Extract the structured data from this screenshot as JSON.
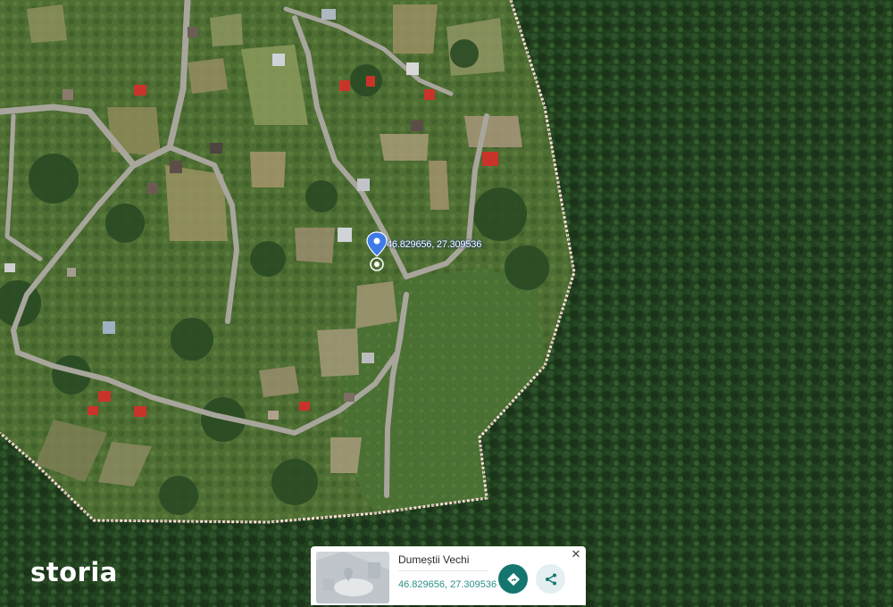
{
  "map": {
    "pin_label": "46.829656, 27.309536",
    "colors": {
      "forest": "#1f3a1c",
      "field": "#5a7a3c",
      "road": "#a7a59c",
      "boundary": "#f3e6df",
      "marker": "#3f7be8",
      "roof_red": "#c9342a"
    }
  },
  "watermark": {
    "text": "storia"
  },
  "info_card": {
    "title": "Dumeștii Vechi",
    "coordinates": "46.829656, 27.309536",
    "directions_icon": "directions-icon",
    "share_icon": "share-icon",
    "close_label": "✕"
  }
}
